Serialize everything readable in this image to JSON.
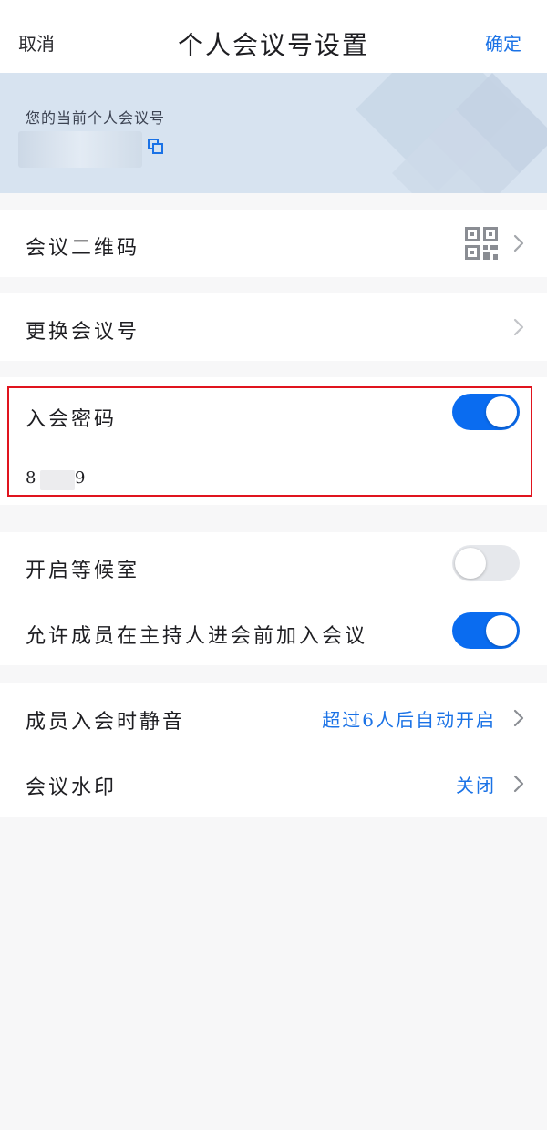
{
  "nav": {
    "cancel_label": "取消",
    "title": "个人会议号设置",
    "confirm_label": "确定"
  },
  "banner": {
    "label": "您的当前个人会议号"
  },
  "rows": {
    "qr_code": {
      "label": "会议二维码",
      "icon": "qr-code-icon"
    },
    "change_number": {
      "label": "更换会议号"
    },
    "password": {
      "label": "入会密码",
      "enabled": true,
      "value_first": "8",
      "value_last": "9"
    },
    "waiting_room": {
      "label": "开启等候室",
      "enabled": false
    },
    "join_before_host": {
      "label": "允许成员在主持人进会前加入会议",
      "enabled": true
    },
    "mute_on_join": {
      "label": "成员入会时静音",
      "value": "超过6人后自动开启"
    },
    "watermark": {
      "label": "会议水印",
      "value": "关闭"
    }
  },
  "colors": {
    "accent": "#1a72e6",
    "toggle_on": "#0a6cf0",
    "toggle_off": "#e6e8ec",
    "banner_bg": "#d7e3f0",
    "highlight_border": "#e0141e"
  }
}
